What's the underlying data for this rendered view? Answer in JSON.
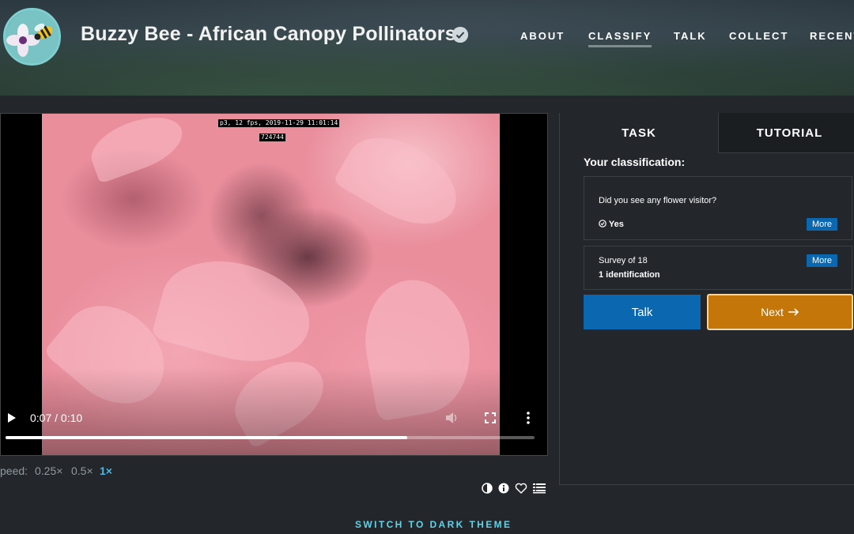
{
  "header": {
    "title": "Buzzy Bee - African Canopy Pollinators",
    "nav": [
      "ABOUT",
      "CLASSIFY",
      "TALK",
      "COLLECT",
      "RECENT"
    ],
    "active_nav": "CLASSIFY"
  },
  "video": {
    "overlay_line1": "p3, 12 fps, 2019-11-29 11:01:14",
    "overlay_line2": "724744",
    "time_display": "0:07 / 0:10",
    "progress_fraction": 0.76
  },
  "speed": {
    "label": "peed:",
    "options": [
      "0.25×",
      "0.5×",
      "1×"
    ],
    "selected": "1×"
  },
  "tabs": {
    "task": "TASK",
    "tutorial": "TUTORIAL"
  },
  "classification": {
    "heading": "Your classification:",
    "question": "Did you see any flower visitor?",
    "answer": "Yes",
    "more_label": "More",
    "survey_label": "Survey of 18",
    "identification_count": "1 identification"
  },
  "buttons": {
    "talk": "Talk",
    "next": "Next"
  },
  "footer": {
    "theme_toggle": "SWITCH TO DARK THEME"
  },
  "colors": {
    "accent_blue": "#0a67b0",
    "next_orange": "#c47708",
    "link_cyan": "#5fd3e8",
    "speed_active": "#4bb8e8"
  }
}
